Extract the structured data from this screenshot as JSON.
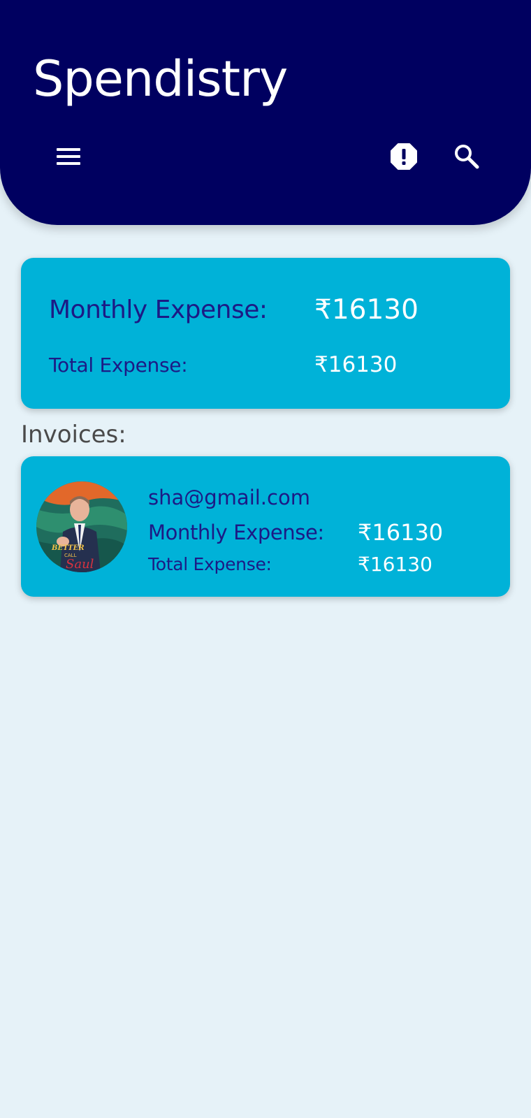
{
  "app": {
    "title": "Spendistry",
    "icons": {
      "menu": "hamburger-menu-icon",
      "alert": "alert-octagon-icon",
      "search": "search-icon"
    }
  },
  "summary": {
    "monthly_label": "Monthly Expense:",
    "monthly_value": "₹16130",
    "total_label": "Total Expense:",
    "total_value": "₹16130"
  },
  "invoices": {
    "section_label": "Invoices:",
    "items": [
      {
        "email": "sha@gmail.com",
        "monthly_label": "Monthly Expense:",
        "monthly_value": "₹16130",
        "total_label": "Total Expense:",
        "total_value": "₹16130",
        "avatar_text_1": "BETTER",
        "avatar_text_2": "CALL",
        "avatar_text_3": "Saul"
      }
    ]
  },
  "colors": {
    "header_bg": "#000060",
    "card_bg": "#00b2d8",
    "page_bg": "#e6f2f8",
    "label_text": "#1c1a85",
    "value_text": "#ffffff"
  }
}
